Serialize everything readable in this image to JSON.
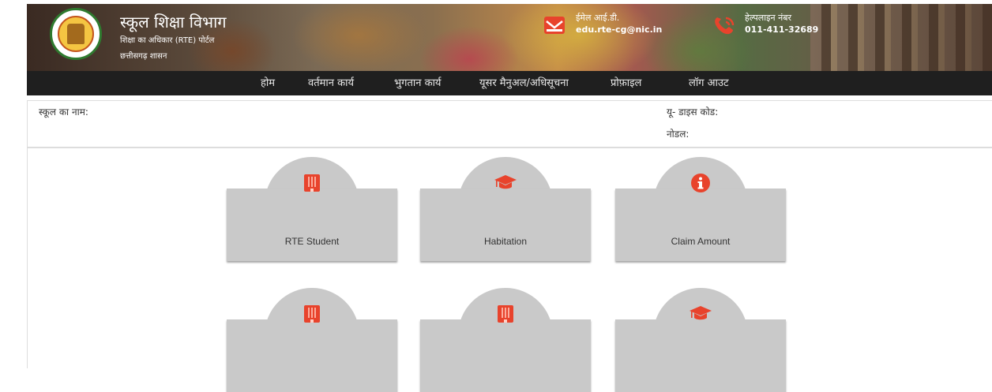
{
  "header": {
    "logo_text": "छत्तीसगढ़ शासन",
    "title": "स्कूल शिक्षा विभाग",
    "subtitle": "शिक्षा का अधिकार (RTE) पोर्टल",
    "state": "छत्तीसगढ़ शासन",
    "email": {
      "label": "ईमेल आई.डी.",
      "value": "edu.rte-cg@nic.in",
      "icon": "email-icon"
    },
    "helpline": {
      "label": "हेल्पलाइन नंबर",
      "value": "011-411-32689",
      "icon": "phone-icon"
    }
  },
  "nav": {
    "items": [
      {
        "label": "होम"
      },
      {
        "label": "वर्तमान कार्य"
      },
      {
        "label": "भुगतान कार्य"
      },
      {
        "label": "यूसर मैनुअल/अधिसूचना"
      },
      {
        "label": "प्रोफ़ाइल"
      },
      {
        "label": "लॉग आउट"
      }
    ]
  },
  "info": {
    "school_name_label": "स्कूल का नाम:",
    "udise_label": "यू- डाइस कोड:",
    "nodal_label": "नोडल:"
  },
  "tiles": [
    {
      "label": "RTE Student",
      "icon": "building-icon"
    },
    {
      "label": "Habitation",
      "icon": "graduation-cap-icon"
    },
    {
      "label": "Claim Amount",
      "icon": "info-icon"
    },
    {
      "label": "",
      "icon": "building-icon"
    },
    {
      "label": "",
      "icon": "building-icon"
    },
    {
      "label": "",
      "icon": "graduation-cap-icon"
    }
  ],
  "colors": {
    "accent": "#e8432c",
    "navbar": "#1f1f1f",
    "tile": "#c9c9c9"
  }
}
